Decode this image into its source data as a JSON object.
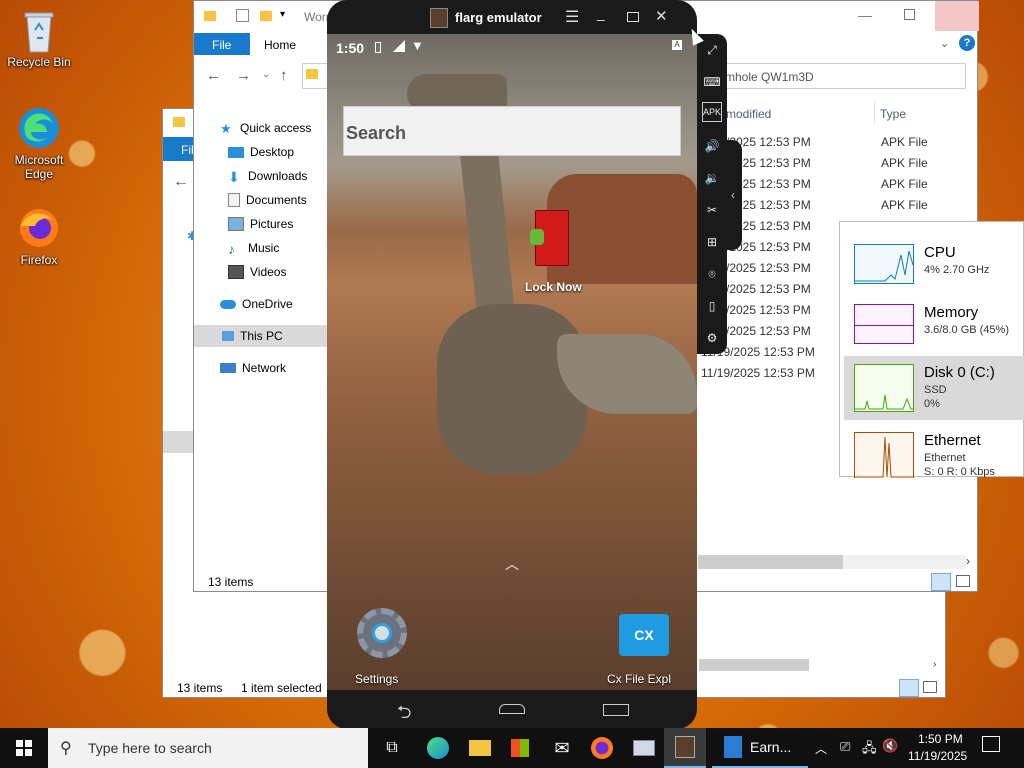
{
  "desktop": {
    "recycle_bin": "Recycle Bin",
    "edge": "Microsoft Edge",
    "firefox": "Firefox"
  },
  "explorer_back": {
    "tab": "Fil",
    "items_count": "13 items",
    "selected": "1 item selected"
  },
  "explorer": {
    "title": "Worm",
    "file_tab": "File",
    "home_tab": "Home",
    "address": "mhole QW1m3D",
    "col_modified": "modified",
    "col_type": "Type",
    "sidebar": [
      "Quick access",
      "Desktop",
      "Downloads",
      "Documents",
      "Pictures",
      "Music",
      "Videos",
      "OneDrive",
      "This PC",
      "Network"
    ],
    "dates": [
      "/2025 12:53 PM",
      "/2025 12:53 PM",
      "/2025 12:53 PM",
      "/2025 12:53 PM",
      "/2025 12:53 PM",
      "/2025 12:53 PM",
      "/2025 12:53 PM",
      "/2025 12:53 PM",
      "/2025 12:53 PM",
      "/2025 12:53 PM",
      "11/19/2025 12:53 PM",
      "11/19/2025 12:53 PM"
    ],
    "types": [
      "APK File",
      "APK File",
      "APK File",
      "APK File"
    ],
    "items_count": "13 items"
  },
  "emulator": {
    "title": "flarg emulator",
    "time": "1:50",
    "search_placeholder": "Search",
    "lock_now": "Lock Now",
    "settings": "Settings",
    "cx_file": "Cx File Expl"
  },
  "task_manager": {
    "cpu": {
      "name": "CPU",
      "value": "4% 2.70 GHz"
    },
    "memory": {
      "name": "Memory",
      "value": "3.6/8.0 GB (45%)"
    },
    "disk": {
      "name": "Disk 0 (C:)",
      "sub": "SSD",
      "value": "0%"
    },
    "ethernet": {
      "name": "Ethernet",
      "sub": "Ethernet",
      "value": "S: 0 R: 0 Kbps"
    }
  },
  "taskbar": {
    "search": "Type here to search",
    "earn_app": "Earn...",
    "time": "1:50 PM",
    "date": "11/19/2025"
  },
  "colors": {
    "accent": "#0078d7",
    "taskbar": "#101010",
    "cpu_graph": "#117dbb",
    "memory_graph": "#8b12ae",
    "disk_graph": "#4da60c",
    "ethernet_graph": "#a74f01"
  }
}
